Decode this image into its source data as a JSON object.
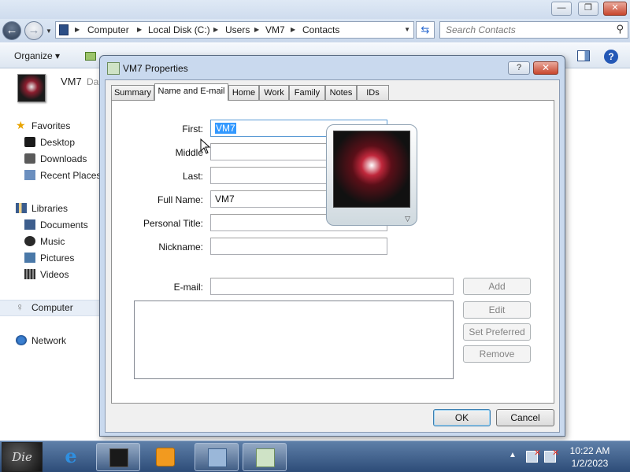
{
  "explorer": {
    "address": {
      "crumbs": [
        "Computer",
        "Local Disk (C:)",
        "Users",
        "VM7",
        "Contacts"
      ]
    },
    "search_placeholder": "Search Contacts",
    "organize_label": "Organize ▾",
    "details": {
      "name": "VM7",
      "sub": "Da"
    },
    "nav": {
      "favorites": "Favorites",
      "desktop": "Desktop",
      "downloads": "Downloads",
      "recent_places": "Recent Places",
      "libraries": "Libraries",
      "documents": "Documents",
      "music": "Music",
      "pictures": "Pictures",
      "videos": "Videos",
      "computer": "Computer",
      "network": "Network"
    }
  },
  "dialog": {
    "title": "VM7 Properties",
    "help_label": "?",
    "close_label": "✕",
    "tabs": [
      "Summary",
      "Name and E-mail",
      "Home",
      "Work",
      "Family",
      "Notes",
      "IDs"
    ],
    "active_tab": "Name and E-mail",
    "fields": {
      "first_label": "First:",
      "first_value": "VM7",
      "middle_label": "Middle",
      "middle_value": "",
      "last_label": "Last:",
      "last_value": "",
      "full_name_label": "Full Name:",
      "full_name_value": "VM7",
      "personal_title_label": "Personal Title:",
      "personal_title_value": "",
      "nickname_label": "Nickname:",
      "nickname_value": "",
      "email_label": "E-mail:",
      "email_value": ""
    },
    "email_buttons": {
      "add": "Add",
      "edit": "Edit",
      "set_preferred": "Set Preferred",
      "remove": "Remove"
    },
    "ok_label": "OK",
    "cancel_label": "Cancel"
  },
  "taskbar": {
    "start_label": "Die",
    "clock_time": "10:22 AM",
    "clock_date": "1/2/2023"
  },
  "colors": {
    "dialog_frame": "#c9d9ee",
    "selection": "#3399ff",
    "taskbar": "#2d4c78"
  }
}
